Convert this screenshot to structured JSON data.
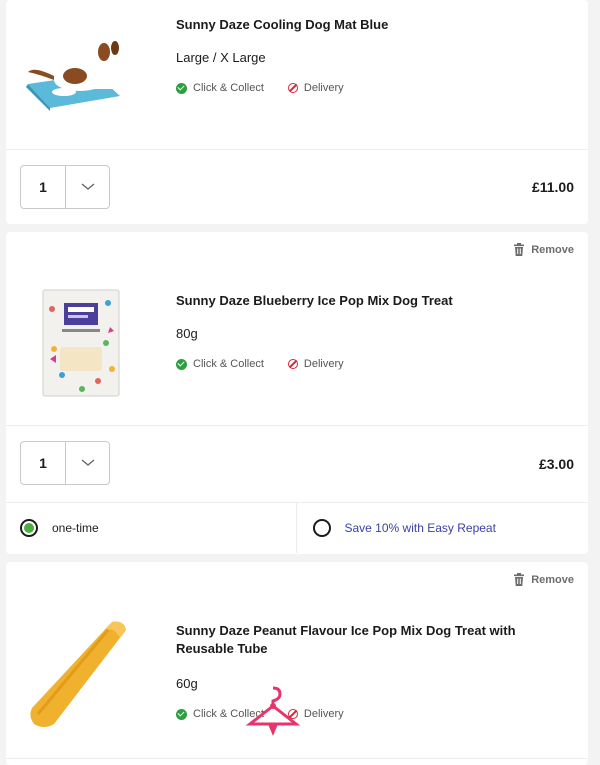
{
  "cart": {
    "items": [
      {
        "title": "Sunny Daze Cooling Dog Mat Blue",
        "variant": "Large / X Large",
        "click_collect": "Click & Collect",
        "delivery": "Delivery",
        "quantity": "1",
        "price": "£11.00"
      },
      {
        "remove": "Remove",
        "title": "Sunny Daze Blueberry Ice Pop Mix Dog Treat",
        "variant": "80g",
        "click_collect": "Click & Collect",
        "delivery": "Delivery",
        "quantity": "1",
        "price": "£3.00",
        "purchase_options": {
          "one_time": "one-time",
          "repeat": "Save 10% with Easy Repeat",
          "selected": "one-time"
        }
      },
      {
        "remove": "Remove",
        "title": "Sunny Daze Peanut Flavour Ice Pop Mix Dog Treat with Reusable Tube",
        "variant": "60g",
        "click_collect": "Click & Collect",
        "delivery": "Delivery"
      }
    ]
  },
  "colors": {
    "available": "#2e9e42",
    "unavailable": "#d6263a",
    "repeat_link": "#3a3fa8",
    "selected_radio": "#4cae3e"
  },
  "icons": [
    "check-circle-icon",
    "no-entry-icon",
    "trash-icon",
    "chevron-down-icon",
    "hanger-cursor-icon"
  ]
}
